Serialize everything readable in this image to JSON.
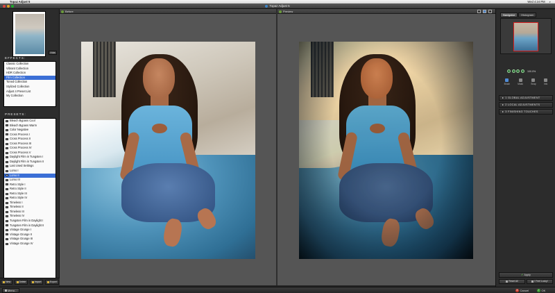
{
  "menubar": {
    "apple_icon": "apple-icon",
    "app_name": "Topaz Adjust 5",
    "clock": "Wed 4:24 PM"
  },
  "window": {
    "title": "Topaz Adjust 5"
  },
  "left_panel": {
    "hide_label": "Hide",
    "effects_label": "EFFECTS:",
    "collections": [
      {
        "label": "Classic Collection",
        "selected": false
      },
      {
        "label": "Vibrant Collection",
        "selected": false
      },
      {
        "label": "HDR Collection",
        "selected": false
      },
      {
        "label": "Film Collection",
        "selected": true
      },
      {
        "label": "Toned Collection",
        "selected": false
      },
      {
        "label": "Stylized Collection",
        "selected": false
      },
      {
        "label": "Adjust 4 Preset List",
        "selected": false
      },
      {
        "label": "My Collection",
        "selected": false
      }
    ],
    "presets_label": "PRESETS:",
    "presets": [
      {
        "label": "Bleach Bypass Cool",
        "selected": false
      },
      {
        "label": "Bleach Bypass Warm",
        "selected": false
      },
      {
        "label": "Color Negative",
        "selected": false
      },
      {
        "label": "Cross Process I",
        "selected": false
      },
      {
        "label": "Cross Process II",
        "selected": false
      },
      {
        "label": "Cross Process III",
        "selected": false
      },
      {
        "label": "Cross Process IV",
        "selected": false
      },
      {
        "label": "Cross Process V",
        "selected": false
      },
      {
        "label": "Daylight Film in Tungsten I",
        "selected": false
      },
      {
        "label": "Daylight Film in Tungsten II",
        "selected": false
      },
      {
        "label": "Last Used Settings",
        "selected": false
      },
      {
        "label": "Lomo I",
        "selected": false
      },
      {
        "label": "Lomo II",
        "selected": true
      },
      {
        "label": "Lomo III",
        "selected": false
      },
      {
        "label": "Retro Style I",
        "selected": false
      },
      {
        "label": "Retro Style II",
        "selected": false
      },
      {
        "label": "Retro Style III",
        "selected": false
      },
      {
        "label": "Retro Style IV",
        "selected": false
      },
      {
        "label": "Timeless I",
        "selected": false
      },
      {
        "label": "Timeless II",
        "selected": false
      },
      {
        "label": "Timeless III",
        "selected": false
      },
      {
        "label": "Timeless IV",
        "selected": false
      },
      {
        "label": "Tungsten Film in Daylight I",
        "selected": false
      },
      {
        "label": "Tungsten Film in Daylight II",
        "selected": false
      },
      {
        "label": "Vintage Grunge I",
        "selected": false
      },
      {
        "label": "Vintage Grunge II",
        "selected": false
      },
      {
        "label": "Vintage Grunge III",
        "selected": false
      },
      {
        "label": "Vintage Grunge IV",
        "selected": false
      }
    ],
    "buttons": {
      "new": "New",
      "delete": "Delete",
      "import": "Import",
      "export": "Export"
    }
  },
  "center": {
    "before_label": "Before",
    "preview_label": "Preview",
    "zoom_readout": "100"
  },
  "right_panel": {
    "tabs": [
      "Navigator",
      "Histogram"
    ],
    "zoom_value": "100.0%",
    "tools": [
      "Brush",
      "Mask",
      "Snap",
      "Info"
    ],
    "accordions": [
      "1 GLOBAL ADJUSTMENT",
      "2 LOCAL ADJUSTMENTS",
      "3 FINISHING TOUCHES"
    ],
    "apply_label": "Apply",
    "reset_all_label": "Reset All",
    "feel_lucky_label": "I Feel Lucky!"
  },
  "bottom": {
    "menu_label": "Menu...",
    "cancel_label": "Cancel",
    "ok_label": "OK"
  },
  "colors": {
    "selection": "#3b6fd6",
    "panel_bg": "#2c2c2c",
    "pane_bg": "#555555",
    "cancel_red": "#c23a2b",
    "ok_green": "#3c9a33"
  }
}
